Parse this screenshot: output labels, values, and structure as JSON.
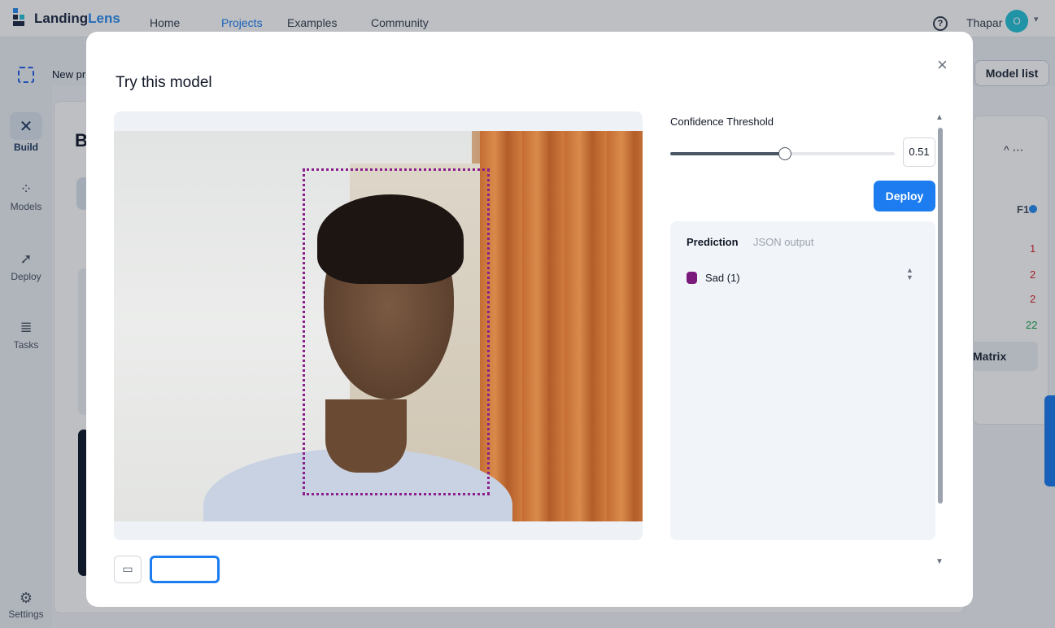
{
  "app": {
    "logo_part1": "Landing",
    "logo_part2": "Lens",
    "nav": [
      {
        "label": "Home"
      },
      {
        "label": "Projects"
      },
      {
        "label": "Examples"
      },
      {
        "label": "Community"
      }
    ],
    "active_nav": "Projects",
    "help_icon": "?",
    "user_name": "Thapar",
    "avatar_initial": "O",
    "accent_color": "#1d7df0"
  },
  "subbar": {
    "project_name": "New pr",
    "model_list_label": "Model list"
  },
  "sidebar": {
    "items": [
      {
        "label": "Build",
        "icon": "wrench-icon"
      },
      {
        "label": "Models",
        "icon": "network-icon"
      },
      {
        "label": "Deploy",
        "icon": "rocket-icon"
      },
      {
        "label": "Tasks",
        "icon": "list-icon"
      }
    ],
    "settings_label": "Settings"
  },
  "background": {
    "heading_partial": "B",
    "f1_label": "F1",
    "values": [
      {
        "text": "1",
        "color": "#dc2626"
      },
      {
        "text": "2",
        "color": "#dc2626"
      },
      {
        "text": "2",
        "color": "#dc2626"
      },
      {
        "text": "22",
        "color": "#16a34a"
      }
    ],
    "matrix_label": "Matrix"
  },
  "modal": {
    "title": "Try this model",
    "close_label": "×",
    "confidence_label": "Confidence Threshold",
    "threshold_value": "0.51",
    "threshold_fraction": 0.51,
    "deploy_label": "Deploy",
    "tabs": {
      "prediction": "Prediction",
      "json": "JSON output"
    },
    "predictions": [
      {
        "label": "Sad (1)",
        "color": "#7b1a7d"
      }
    ],
    "bbox_color": "#8a1f8c"
  }
}
